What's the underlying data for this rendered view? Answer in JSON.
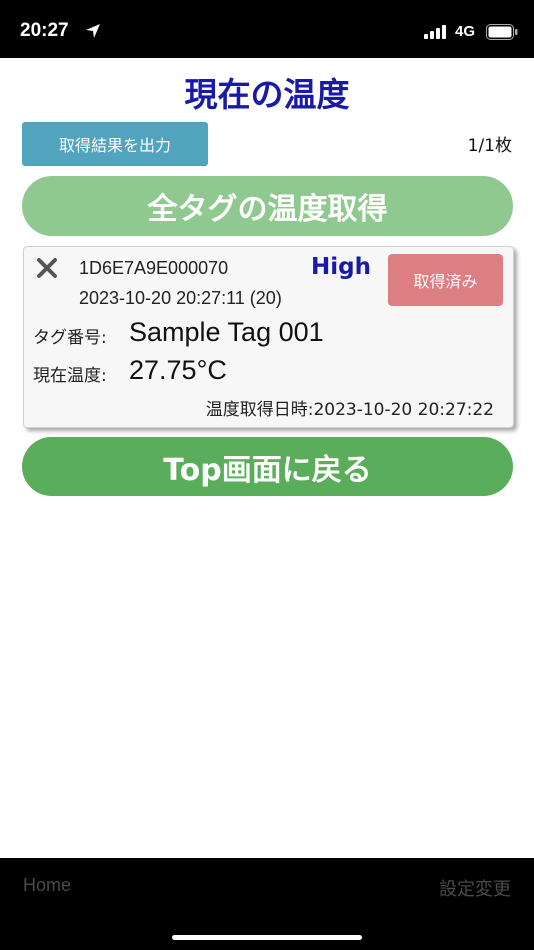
{
  "status_bar": {
    "time": "20:27",
    "network": "4G",
    "icons": [
      "location-arrow-icon",
      "signal-icon",
      "battery-icon"
    ]
  },
  "page": {
    "title": "現在の温度",
    "export_label": "取得結果を出力",
    "page_count": "1/1枚",
    "fetch_all_label": "全タグの温度取得",
    "back_label": "Top画面に戻る"
  },
  "tag_card": {
    "tag_id": "1D6E7A9E000070",
    "level": "High",
    "acquired_at": "2023-10-20 20:27:11 (20)",
    "status_label": "取得済み",
    "tag_number_label": "タグ番号:",
    "tag_number_value": "Sample Tag 001",
    "current_temp_label": "現在温度:",
    "current_temp_value": "27.75°C",
    "temp_time": "温度取得日時:2023-10-20 20:27:22"
  },
  "tab_bar": {
    "home_label": "Home",
    "settings_label": "設定変更"
  },
  "colors": {
    "title": "#1a1aa8",
    "export_button": "#52a3bd",
    "fetch_all_button": "#8fc98f",
    "back_button": "#5aad5a",
    "status_button": "#dd7f82"
  }
}
